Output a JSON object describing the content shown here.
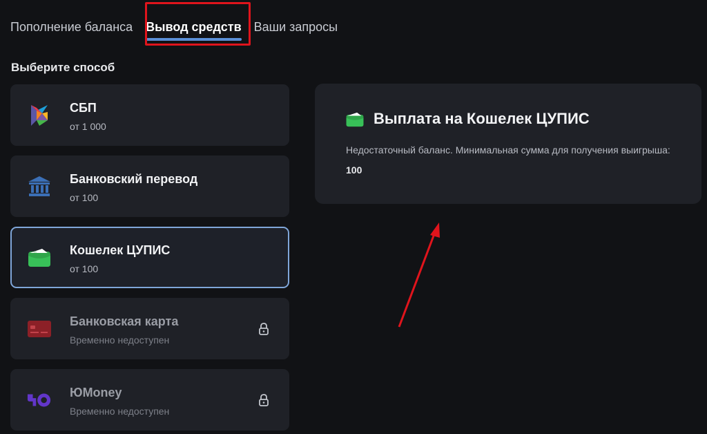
{
  "tabs": [
    {
      "label": "Пополнение баланса"
    },
    {
      "label": "Вывод средств"
    },
    {
      "label": "Ваши запросы"
    }
  ],
  "section_title": "Выберите способ",
  "methods": [
    {
      "name": "СБП",
      "sub": "от 1 000",
      "icon": "sbp-logo-icon",
      "state": "available"
    },
    {
      "name": "Банковский перевод",
      "sub": "от 100",
      "icon": "bank-building-icon",
      "state": "available"
    },
    {
      "name": "Кошелек ЦУПИС",
      "sub": "от 100",
      "icon": "wallet-icon",
      "state": "selected"
    },
    {
      "name": "Банковская карта",
      "sub": "Временно недоступен",
      "icon": "credit-card-icon",
      "state": "locked"
    },
    {
      "name": "ЮMoney",
      "sub": "Временно недоступен",
      "icon": "yoomoney-logo-icon",
      "state": "locked"
    }
  ],
  "panel": {
    "title": "Выплата на Кошелек ЦУПИС",
    "text": "Недостаточный баланс. Минимальная сумма для получения выигрыша: ",
    "min_amount": "100"
  },
  "colors": {
    "background": "#111215",
    "card": "#1f2127",
    "accent": "#5b8fd6",
    "selected_border": "#7fa6d9",
    "annotation": "#e0141c"
  }
}
